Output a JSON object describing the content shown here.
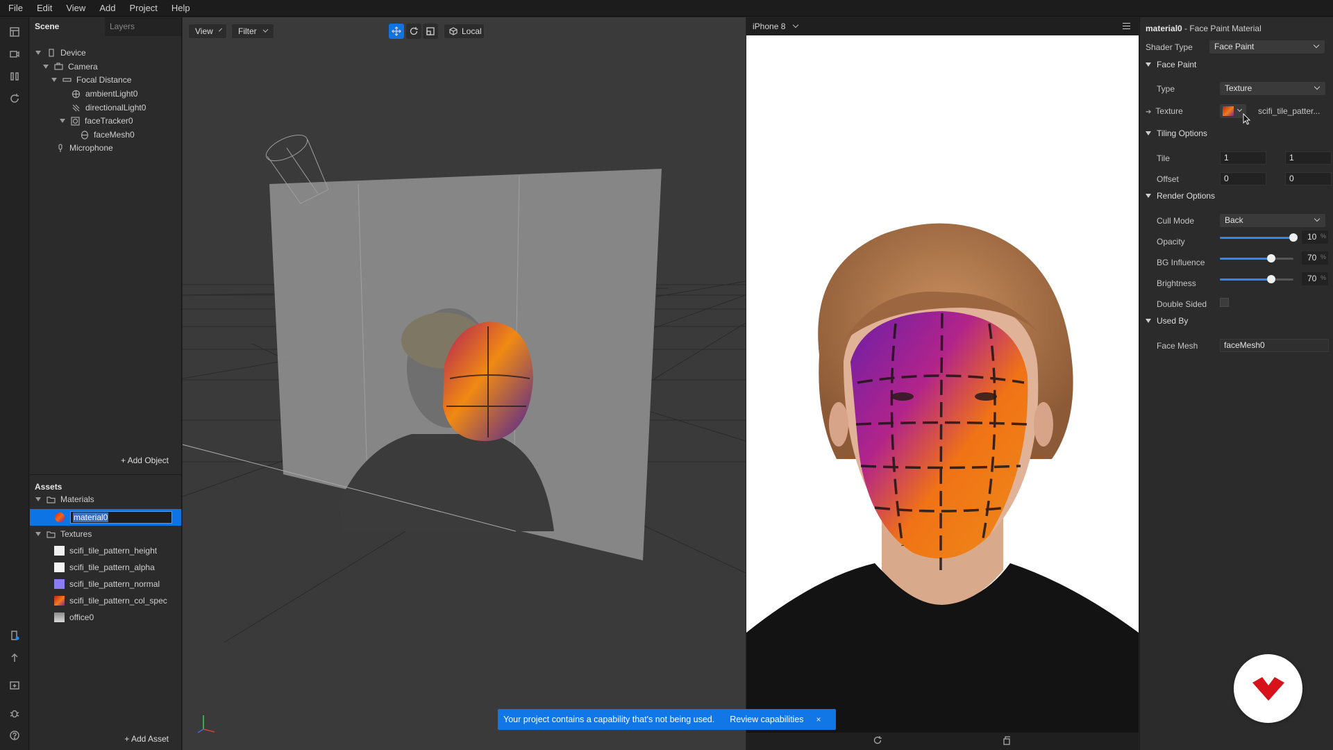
{
  "menubar": {
    "items": [
      "File",
      "Edit",
      "View",
      "Add",
      "Project",
      "Help"
    ]
  },
  "scene": {
    "tabs": [
      "Scene",
      "Layers"
    ],
    "tree": [
      "Device",
      "Camera",
      "Focal Distance",
      "ambientLight0",
      "directionalLight0",
      "faceTracker0",
      "faceMesh0",
      "Microphone"
    ],
    "add_object": "+ Add Object"
  },
  "assets": {
    "title": "Assets",
    "materials_folder": "Materials",
    "selected_material": "material0",
    "textures_folder": "Textures",
    "textures": [
      "scifi_tile_pattern_height",
      "scifi_tile_pattern_alpha",
      "scifi_tile_pattern_normal",
      "scifi_tile_pattern_col_spec",
      "office0"
    ],
    "add_asset": "+ Add Asset"
  },
  "viewport": {
    "view_label": "View",
    "filter_label": "Filter",
    "space_label": "Local"
  },
  "preview": {
    "device": "iPhone 8"
  },
  "inspector": {
    "title_name": "material0",
    "title_type": " - Face Paint Material",
    "shader_type_label": "Shader Type",
    "shader_type_value": "Face Paint",
    "face_paint_section": "Face Paint",
    "type_label": "Type",
    "type_value": "Texture",
    "texture_label": "Texture",
    "texture_value": "scifi_tile_patter...",
    "tiling_section": "Tiling Options",
    "tile_label": "Tile",
    "tile_x": "1",
    "tile_y": "1",
    "offset_label": "Offset",
    "offset_x": "0",
    "offset_y": "0",
    "render_section": "Render Options",
    "cull_label": "Cull Mode",
    "cull_value": "Back",
    "opacity_label": "Opacity",
    "opacity_value": "10",
    "opacity_level": 1.0,
    "bg_label": "BG Influence",
    "bg_value": "70",
    "bg_level": 0.7,
    "brightness_label": "Brightness",
    "brightness_value": "70",
    "brightness_level": 0.7,
    "pct_symbol": "%",
    "double_sided_label": "Double Sided",
    "used_by_section": "Used By",
    "face_mesh_label": "Face Mesh",
    "face_mesh_value": "faceMesh0"
  },
  "toast": {
    "message": "Your project contains a capability that's not being used.",
    "action": "Review capabilities",
    "close": "×"
  },
  "colors": {
    "accent": "#1277e6",
    "selection": "#0d74e6",
    "badge": "#d8121b"
  }
}
